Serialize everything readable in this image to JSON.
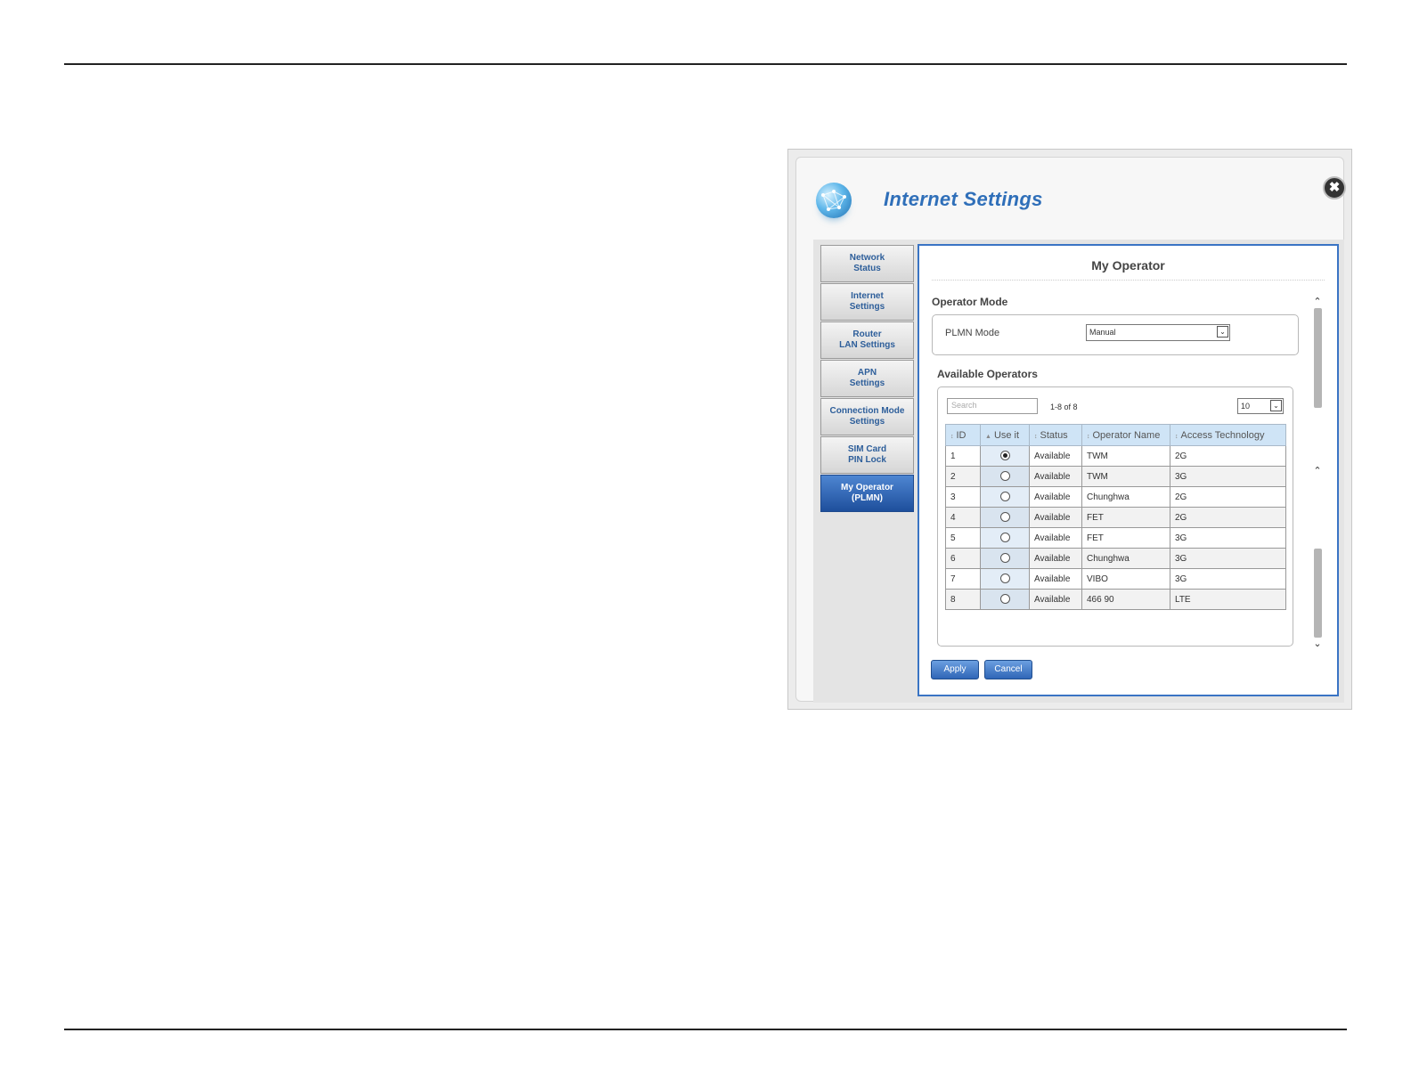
{
  "dialog": {
    "title": "Internet Settings",
    "close_glyph": "✖",
    "icon": "globe-icon"
  },
  "sidebar": {
    "items": [
      {
        "line1": "Network",
        "line2": "Status",
        "active": false
      },
      {
        "line1": "Internet",
        "line2": "Settings",
        "active": false
      },
      {
        "line1": "Router",
        "line2": "LAN Settings",
        "active": false
      },
      {
        "line1": "APN",
        "line2": "Settings",
        "active": false
      },
      {
        "line1": "Connection Mode",
        "line2": "Settings",
        "active": false
      },
      {
        "line1": "SIM Card",
        "line2": "PIN Lock",
        "active": false
      },
      {
        "line1": "My Operator",
        "line2": "(PLMN)",
        "active": true
      }
    ]
  },
  "panel": {
    "title": "My Operator",
    "operator_mode_heading": "Operator Mode",
    "plmn_mode_label": "PLMN Mode",
    "plmn_mode_value": "Manual",
    "available_heading": "Available Operators",
    "search_placeholder": "Search",
    "count_text": "1-8 of 8",
    "page_size": "10",
    "columns": [
      "ID",
      "Use it",
      "Status",
      "Operator Name",
      "Access Technology"
    ],
    "rows": [
      {
        "id": "1",
        "selected": true,
        "status": "Available",
        "name": "TWM",
        "tech": "2G"
      },
      {
        "id": "2",
        "selected": false,
        "status": "Available",
        "name": "TWM",
        "tech": "3G"
      },
      {
        "id": "3",
        "selected": false,
        "status": "Available",
        "name": "Chunghwa",
        "tech": "2G"
      },
      {
        "id": "4",
        "selected": false,
        "status": "Available",
        "name": "FET",
        "tech": "2G"
      },
      {
        "id": "5",
        "selected": false,
        "status": "Available",
        "name": "FET",
        "tech": "3G"
      },
      {
        "id": "6",
        "selected": false,
        "status": "Available",
        "name": "Chunghwa",
        "tech": "3G"
      },
      {
        "id": "7",
        "selected": false,
        "status": "Available",
        "name": "VIBO",
        "tech": "3G"
      },
      {
        "id": "8",
        "selected": false,
        "status": "Available",
        "name": "466 90",
        "tech": "LTE"
      }
    ],
    "apply_label": "Apply",
    "cancel_label": "Cancel"
  },
  "colors": {
    "accent": "#2f6fb9",
    "active_nav": "#1e4f9c",
    "header_row": "#cfe4f6"
  }
}
